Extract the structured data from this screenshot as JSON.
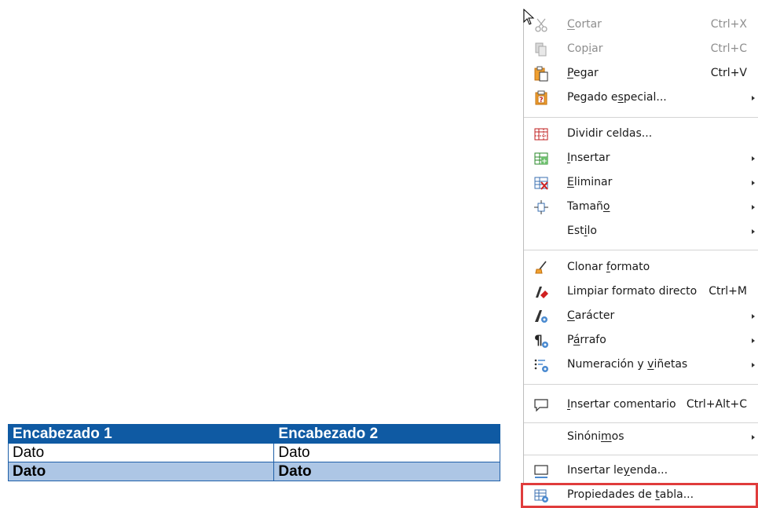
{
  "table": {
    "headers": [
      "Encabezado 1",
      "Encabezado 2"
    ],
    "rows": [
      [
        "Dato",
        "Dato"
      ],
      [
        "Dato",
        "Dato"
      ]
    ]
  },
  "menu": {
    "cut": {
      "pre": "",
      "u": "C",
      "post": "ortar",
      "shortcut": "Ctrl+X"
    },
    "copy": {
      "pre": "Cop",
      "u": "i",
      "post": "ar",
      "shortcut": "Ctrl+C"
    },
    "paste": {
      "pre": "",
      "u": "P",
      "post": "egar",
      "shortcut": "Ctrl+V"
    },
    "paste_special": {
      "pre": "Pegado e",
      "u": "s",
      "post": "pecial..."
    },
    "split_cells": {
      "pre": "Dividir celdas...",
      "u": "",
      "post": ""
    },
    "insert": {
      "pre": "",
      "u": "I",
      "post": "nsertar"
    },
    "delete": {
      "pre": "",
      "u": "E",
      "post": "liminar"
    },
    "size": {
      "pre": "Tamañ",
      "u": "o",
      "post": ""
    },
    "style": {
      "pre": "Est",
      "u": "i",
      "post": "lo"
    },
    "clone_format": {
      "pre": "Clonar ",
      "u": "f",
      "post": "ormato"
    },
    "clear_format": {
      "pre": "Limpiar formato directo",
      "u": "",
      "post": "",
      "shortcut": "Ctrl+M"
    },
    "character": {
      "pre": "",
      "u": "C",
      "post": "arácter"
    },
    "paragraph": {
      "pre": "P",
      "u": "á",
      "post": "rrafo"
    },
    "numbering": {
      "pre": "Numeración y ",
      "u": "v",
      "post": "iñetas"
    },
    "insert_comment": {
      "pre": "",
      "u": "I",
      "post": "nsertar comentario",
      "shortcut": "Ctrl+Alt+C"
    },
    "synonyms": {
      "pre": "Sinóni",
      "u": "m",
      "post": "os"
    },
    "insert_caption": {
      "pre": "Insertar le",
      "u": "y",
      "post": "enda..."
    },
    "table_properties": {
      "pre": "Propiedades de ",
      "u": "t",
      "post": "abla..."
    }
  },
  "colors": {
    "header_bg": "#0f5aa3",
    "total_row_bg": "#adc6e5",
    "highlight_outline": "#e03c3c"
  }
}
